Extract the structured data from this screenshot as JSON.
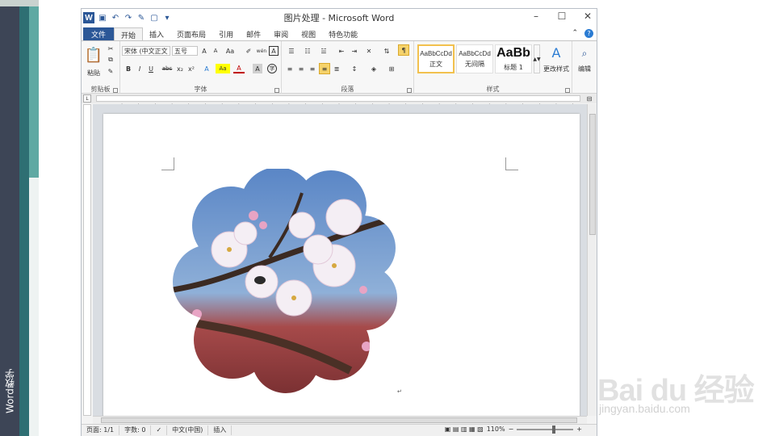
{
  "slide": {
    "side_label": "Word教学"
  },
  "window": {
    "title": "图片处理 - Microsoft Word",
    "app_icon": "W",
    "controls": {
      "minimize": "–",
      "maximize": "☐",
      "close": "✕"
    }
  },
  "quick_access": [
    "save-icon",
    "undo-icon",
    "redo-icon",
    "format-painter-icon",
    "new-doc-icon",
    "more-icon"
  ],
  "tabs": {
    "file": "文件",
    "items": [
      "开始",
      "插入",
      "页面布局",
      "引用",
      "邮件",
      "审阅",
      "视图",
      "特色功能"
    ],
    "active": "开始",
    "help": "?"
  },
  "ribbon": {
    "clipboard": {
      "paste": "粘贴",
      "label": "剪贴板"
    },
    "font": {
      "family": "宋体 (中文正文",
      "size": "五号",
      "label": "字体",
      "buttons": [
        "B",
        "I",
        "U",
        "abc",
        "x₂",
        "x²",
        "A",
        "Aa",
        "A",
        "A"
      ],
      "grow": "A",
      "shrink": "A",
      "change_case": "Aa",
      "phonetic": "wén",
      "char_border": "A"
    },
    "paragraph": {
      "label": "段落"
    },
    "styles": {
      "label": "样式",
      "items": [
        {
          "sample": "AaBbCcDd",
          "name": "正文"
        },
        {
          "sample": "AaBbCcDd",
          "name": "无间隔"
        },
        {
          "sample": "AaBb",
          "name": "标题 1"
        }
      ],
      "change_styles": "更改样式"
    },
    "editing": {
      "label": "编辑"
    }
  },
  "ruler": {
    "marks": [
      "8",
      "6",
      "4",
      "2",
      "2",
      "4",
      "6",
      "8",
      "10",
      "12",
      "14",
      "16",
      "18",
      "20",
      "22",
      "24",
      "26",
      "28",
      "30",
      "32",
      "34",
      "36",
      "38",
      "40",
      "42",
      "44",
      "46",
      "48"
    ]
  },
  "status": {
    "page": "页面: 1/1",
    "words": "字数: 0",
    "language": "中文(中国)",
    "mode": "插入",
    "zoom": "110%",
    "zoom_minus": "−",
    "zoom_plus": "+"
  },
  "watermark": {
    "logo": "Bai du 经验",
    "url": "jingyan.baidu.com"
  },
  "colors": {
    "accent": "#2b5797",
    "side_dark": "#3d4556",
    "side_teal": "#2e6f73",
    "highlight": "#f2c14e"
  }
}
